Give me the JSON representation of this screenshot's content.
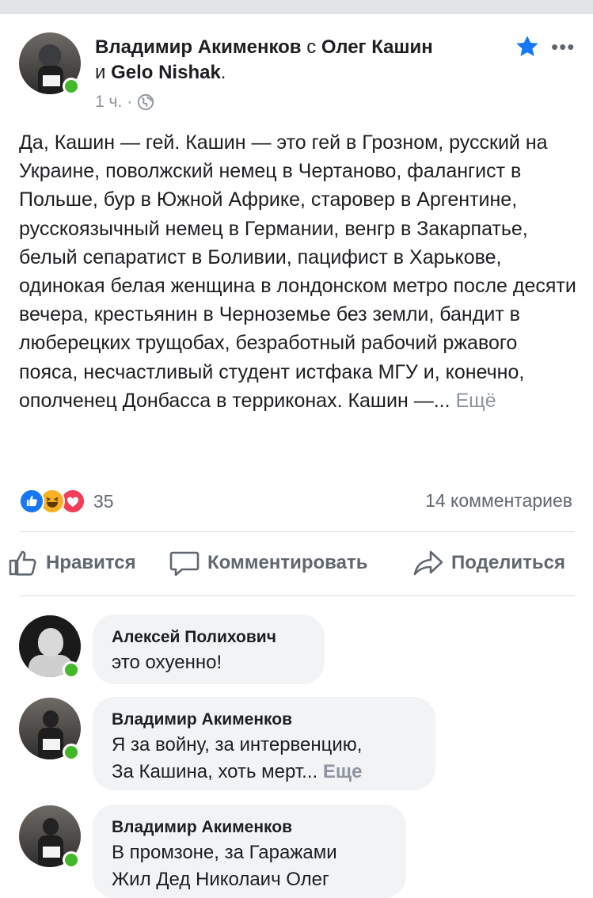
{
  "post": {
    "author": "Владимир Акименков",
    "with_word": "с",
    "tagged_1": "Олег Кашин",
    "and_word": "и",
    "tagged_2": "Gelo Nishak",
    "period": ".",
    "time": "1 ч.",
    "dot": "·",
    "privacy_icon": "globe-icon",
    "text": "Да, Кашин — гей. Кашин — это гей в Грозном, русский на Украине, поволжский немец в Чертаново, фалангист в Польше, бур в Южной Африке, старовер в Аргентине, русскоязычный немец в Германии, венгр в Закарпатье, белый сепаратист в Боливии, пацифист в Харькове, одинокая белая женщина в лондонском метро после десяти вечера, крестьянин в Черноземье без земли, бандит в люберецких трущобах, безработный рабочий ржавого пояса, несчастливый студент истфака МГУ и, конечно, ополченец Донбасса в терриконах. Кашин —...",
    "more_label": "Ещё",
    "reaction_count": "35",
    "comments_count": "14 комментариев"
  },
  "actions": {
    "like_label": "Нравится",
    "comment_label": "Комментировать",
    "share_label": "Поделиться"
  },
  "comments": [
    {
      "author": "Алексей Полихович",
      "text": "это охуенно!"
    },
    {
      "author": "Владимир Акименков",
      "line1": "Я за войну, за интервенцию,",
      "line2": "За Кашина, хоть мерт...",
      "more_label": "Еще"
    },
    {
      "author": "Владимир Акименков",
      "line1": "В промзоне, за Гаражами",
      "line2": "Жил Дед Николаич Олег"
    }
  ],
  "colors": {
    "link_blue": "#1877f2",
    "online_green": "#42b72a",
    "muted_text": "#8d949e",
    "bubble_bg": "#f2f3f5"
  }
}
